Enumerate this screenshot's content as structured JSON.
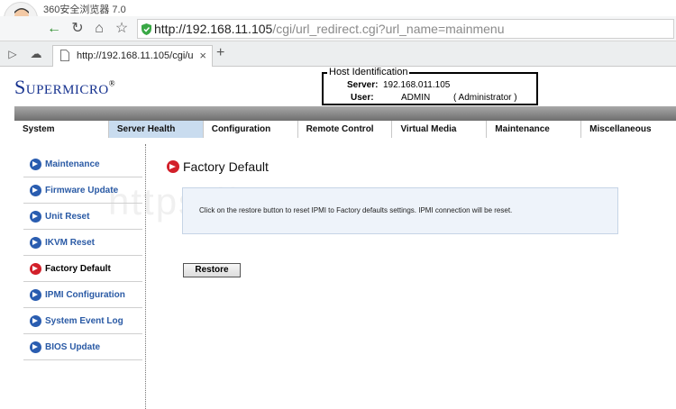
{
  "browser": {
    "name": "360安全浏览器 7.0",
    "url_host": "http://192.168.11.105",
    "url_path": "/cgi/url_redirect.cgi?url_name=mainmenu",
    "tab_title": "http://192.168.11.105/cgi/u",
    "tab_close": "×",
    "new_tab": "+"
  },
  "header": {
    "logo": "Supermicro",
    "logo_mark": "®",
    "host_legend": "Host Identification",
    "server_label": "Server:",
    "server_value": "192.168.011.105",
    "user_label": "User:",
    "user_value": "ADMIN",
    "user_role": "( Administrator )"
  },
  "menu": [
    {
      "label": "System"
    },
    {
      "label": "Server Health"
    },
    {
      "label": "Configuration"
    },
    {
      "label": "Remote Control"
    },
    {
      "label": "Virtual Media"
    },
    {
      "label": "Maintenance"
    },
    {
      "label": "Miscellaneous"
    }
  ],
  "sidebar": [
    {
      "label": "Maintenance"
    },
    {
      "label": "Firmware Update"
    },
    {
      "label": "Unit Reset"
    },
    {
      "label": "IKVM Reset"
    },
    {
      "label": "Factory Default"
    },
    {
      "label": "IPMI Configuration"
    },
    {
      "label": "System Event Log"
    },
    {
      "label": "BIOS Update"
    }
  ],
  "main": {
    "title": "Factory Default",
    "info": "Click on the restore button to reset IPMI to Factory defaults settings. IPMI connection will be reset.",
    "restore_label": "Restore"
  },
  "watermark": "https://www.58pxe.com",
  "colors": {
    "brand_blue": "#16328f",
    "link_blue": "#2a5aa5",
    "active_red": "#d2202a",
    "menu_active": "#c9dcef"
  }
}
